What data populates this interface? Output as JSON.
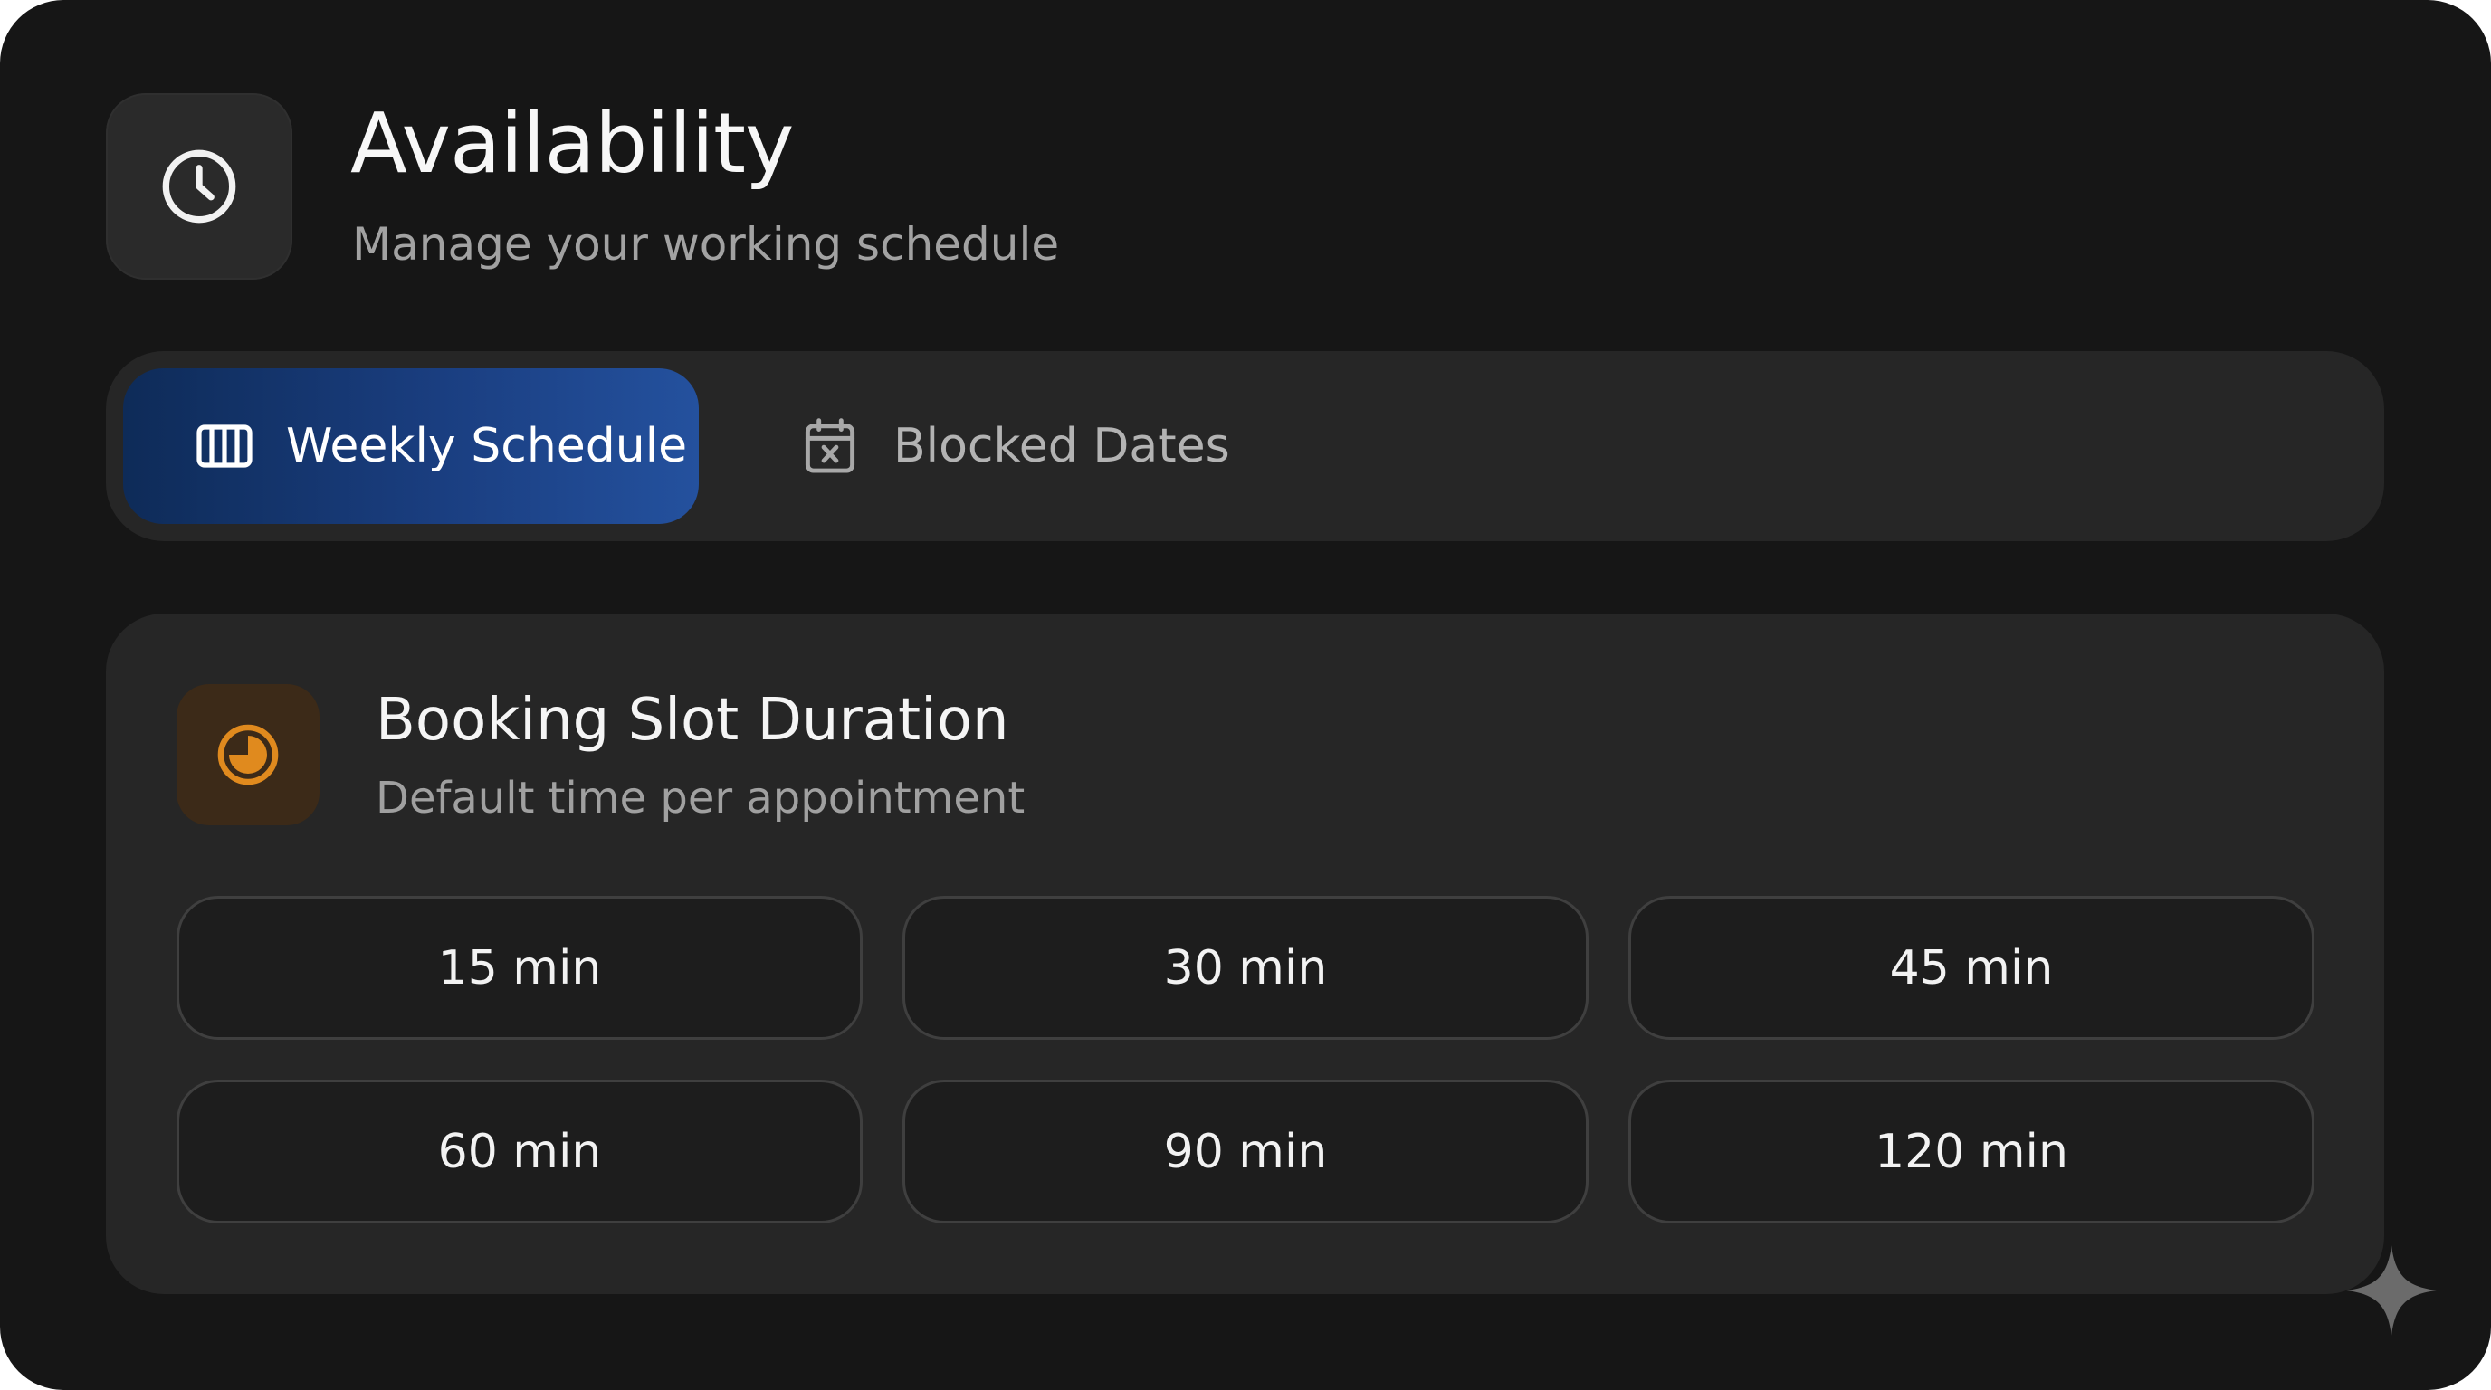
{
  "header": {
    "icon": "clock-icon",
    "title": "Availability",
    "subtitle": "Manage your working schedule"
  },
  "tabs": [
    {
      "label": "Weekly Schedule",
      "icon": "columns-icon",
      "active": true
    },
    {
      "label": "Blocked Dates",
      "icon": "calendar-x-icon",
      "active": false
    }
  ],
  "slot_card": {
    "icon": "timer-icon",
    "title": "Booking Slot Duration",
    "subtitle": "Default time per appointment",
    "options": [
      "15 min",
      "30 min",
      "45 min",
      "60 min",
      "90 min",
      "120 min"
    ]
  },
  "colors": {
    "background": "#161616",
    "surface": "#262626",
    "active_tab_start": "#0e2b58",
    "active_tab_end": "#24519e",
    "accent_orange": "#e08a1e",
    "option_border": "#3f3f3f"
  }
}
